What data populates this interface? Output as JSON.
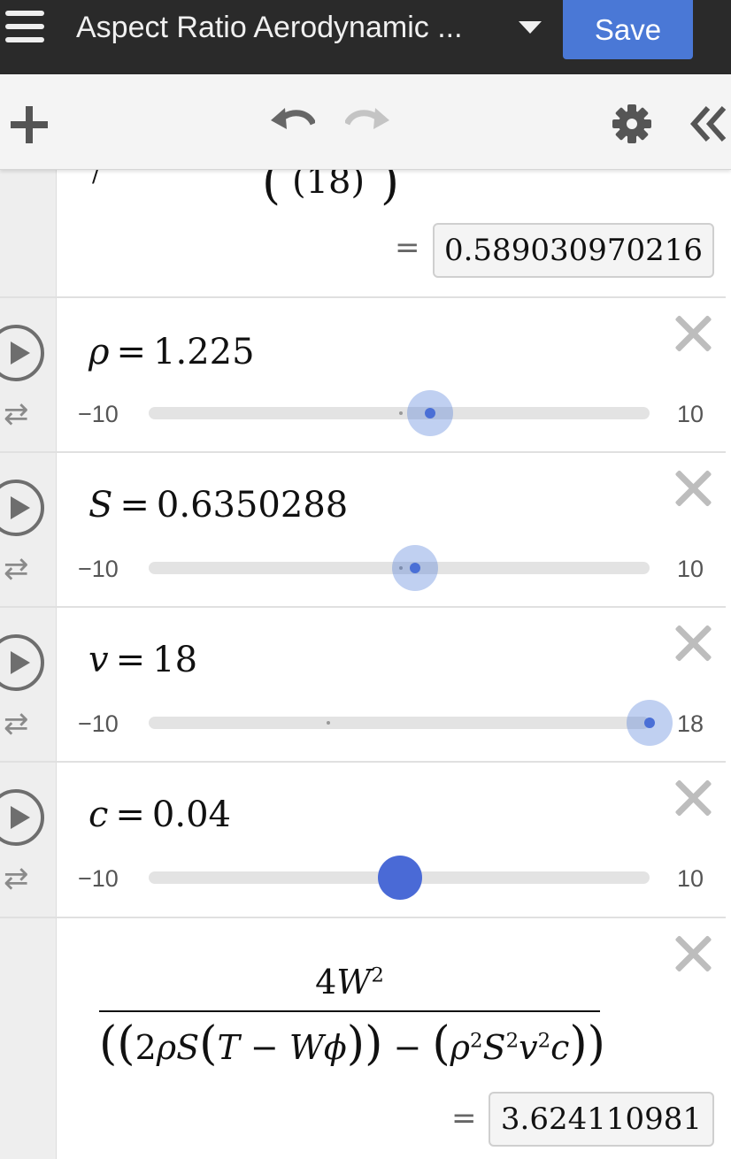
{
  "app": {
    "title": "Aspect Ratio Aerodynamic ...",
    "save_label": "Save"
  },
  "toolbar": {
    "add_icon": "plus-icon",
    "undo_icon": "undo-icon",
    "redo_icon": "redo-icon",
    "settings_icon": "gear-icon",
    "collapse_icon": "double-chevron-left-icon"
  },
  "expressions": {
    "partial_top": {
      "fragment": "(18)",
      "result": "0.589030970216"
    },
    "rho": {
      "var": "ρ",
      "value": "1.225",
      "min": "−10",
      "max": "10",
      "level": 0.56125
    },
    "S": {
      "var": "S",
      "value": "0.6350288",
      "min": "−10",
      "max": "10",
      "level": 0.53175
    },
    "v": {
      "var": "v",
      "value": "18",
      "min": "−10",
      "max": "18",
      "level": 1.0
    },
    "c": {
      "var": "c",
      "value": "0.04",
      "min": "−10",
      "max": "10",
      "level": 0.502
    },
    "formula": {
      "result": "3.624110981"
    }
  },
  "colors": {
    "topbar": "#2a2a2a",
    "accent": "#4a78d6",
    "toolbar": "#f4f4f4"
  }
}
